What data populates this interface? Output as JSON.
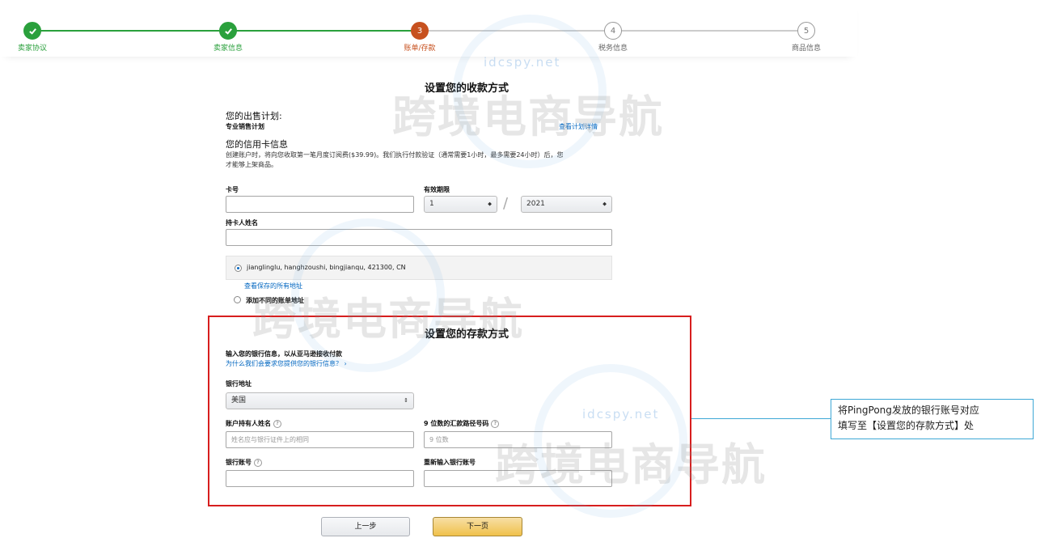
{
  "steps": [
    {
      "number": "✔",
      "label": "卖家协议",
      "state": "done"
    },
    {
      "number": "✔",
      "label": "卖家信息",
      "state": "done"
    },
    {
      "number": "3",
      "label": "账单/存款",
      "state": "current"
    },
    {
      "number": "4",
      "label": "税务信息",
      "state": "todo"
    },
    {
      "number": "5",
      "label": "商品信息",
      "state": "todo"
    }
  ],
  "payment": {
    "title": "设置您的收款方式",
    "plan_heading": "您的出售计划:",
    "plan_name": "专业销售计划",
    "plan_link": "查看计划详情",
    "card_heading": "您的信用卡信息",
    "card_note_line1": "创建账户时，将向您收取第一笔月度订阅费($39.99)。我们执行付款验证（通常需要1小时，最多需要24小时）后，您",
    "card_note_line2": "才能够上架商品。",
    "card_number_label": "卡号",
    "card_number_value": "",
    "expiry_label": "有效期限",
    "expiry_month": "1",
    "expiry_separator": "/",
    "expiry_year": "2021",
    "holder_label": "持卡人姓名",
    "holder_value": "",
    "address_text": "jianglinglu, hanghzoushi, bingjianqu, 421300, CN",
    "view_addresses_link": "查看保存的所有地址",
    "add_address_label": "添加不同的账单地址"
  },
  "deposit": {
    "title": "设置您的存款方式",
    "intro": "输入您的银行信息，以从亚马逊接收付款",
    "why_link": "为什么我们会要求您提供您的银行信息？ ›",
    "bank_location_label": "银行地址",
    "bank_location_value": "美国",
    "account_holder_label": "账户持有人姓名",
    "account_holder_placeholder": "姓名应与银行证件上的相同",
    "routing_label": "9 位数的汇款路径号码",
    "routing_placeholder": "9 位数",
    "account_number_label": "银行账号",
    "reenter_label": "重新输入银行账号"
  },
  "buttons": {
    "prev": "上一步",
    "next": "下一页"
  },
  "callout": {
    "line1": "将PingPong发放的银行账号对应",
    "line2": "填写至【设置您的存款方式】处"
  },
  "watermark": {
    "text": "跨境电商导航",
    "url": "idcspy.net"
  },
  "colors": {
    "done": "#2aa03c",
    "current": "#c7511f",
    "highlight": "#d71e1e",
    "callout": "#3ea8d6",
    "primary_button": "#f0c14b",
    "link": "#0066c0"
  }
}
